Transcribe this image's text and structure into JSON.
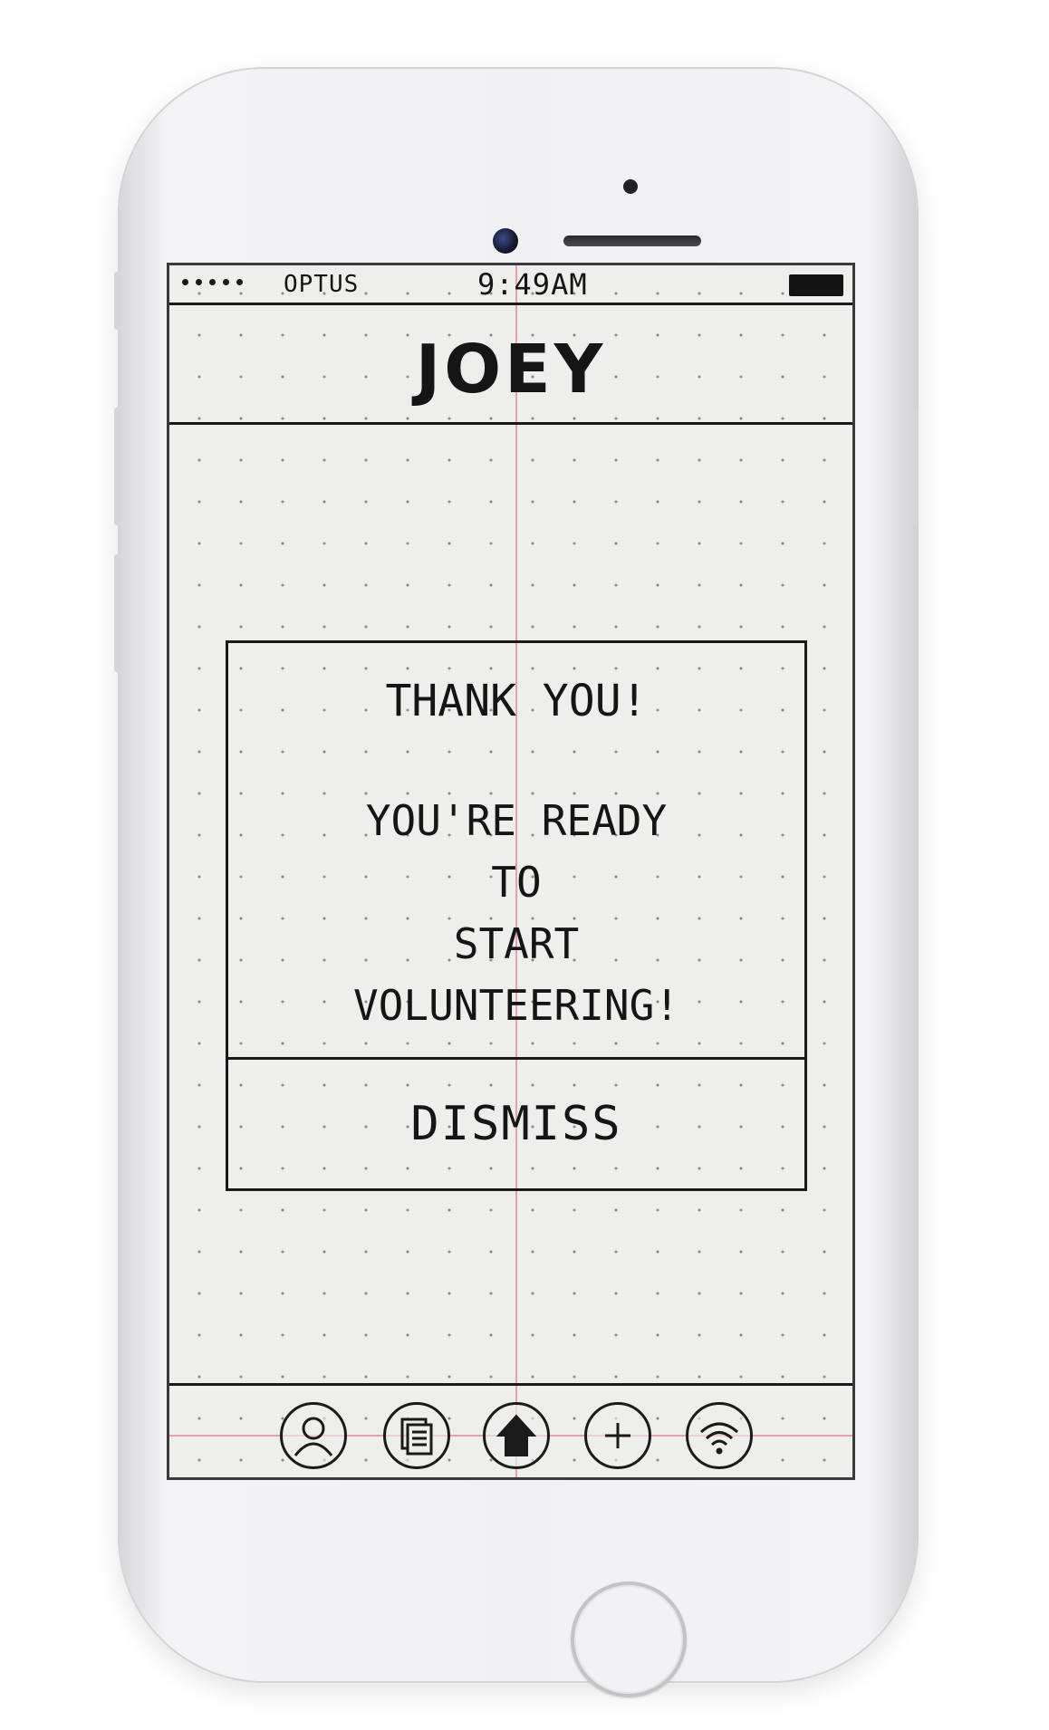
{
  "status_bar": {
    "carrier": "OPTUS",
    "time": "9:49AM"
  },
  "header": {
    "title": "JOEY"
  },
  "dialog": {
    "thanks": "THANK YOU!",
    "message_lines": [
      "YOU'RE READY",
      "TO",
      "START",
      "VOLUNTEERING!"
    ],
    "dismiss_label": "DISMISS"
  },
  "tab_bar": {
    "tabs": [
      {
        "icon": "profile-icon"
      },
      {
        "icon": "documents-icon"
      },
      {
        "icon": "home-icon"
      },
      {
        "icon": "add-icon"
      },
      {
        "icon": "wifi-icon"
      }
    ]
  },
  "colors": {
    "paper": "#eeeeec",
    "ink": "#1a1a1a",
    "margin_line": "#e8a0b0",
    "phone_body": "#f1f1f4"
  }
}
